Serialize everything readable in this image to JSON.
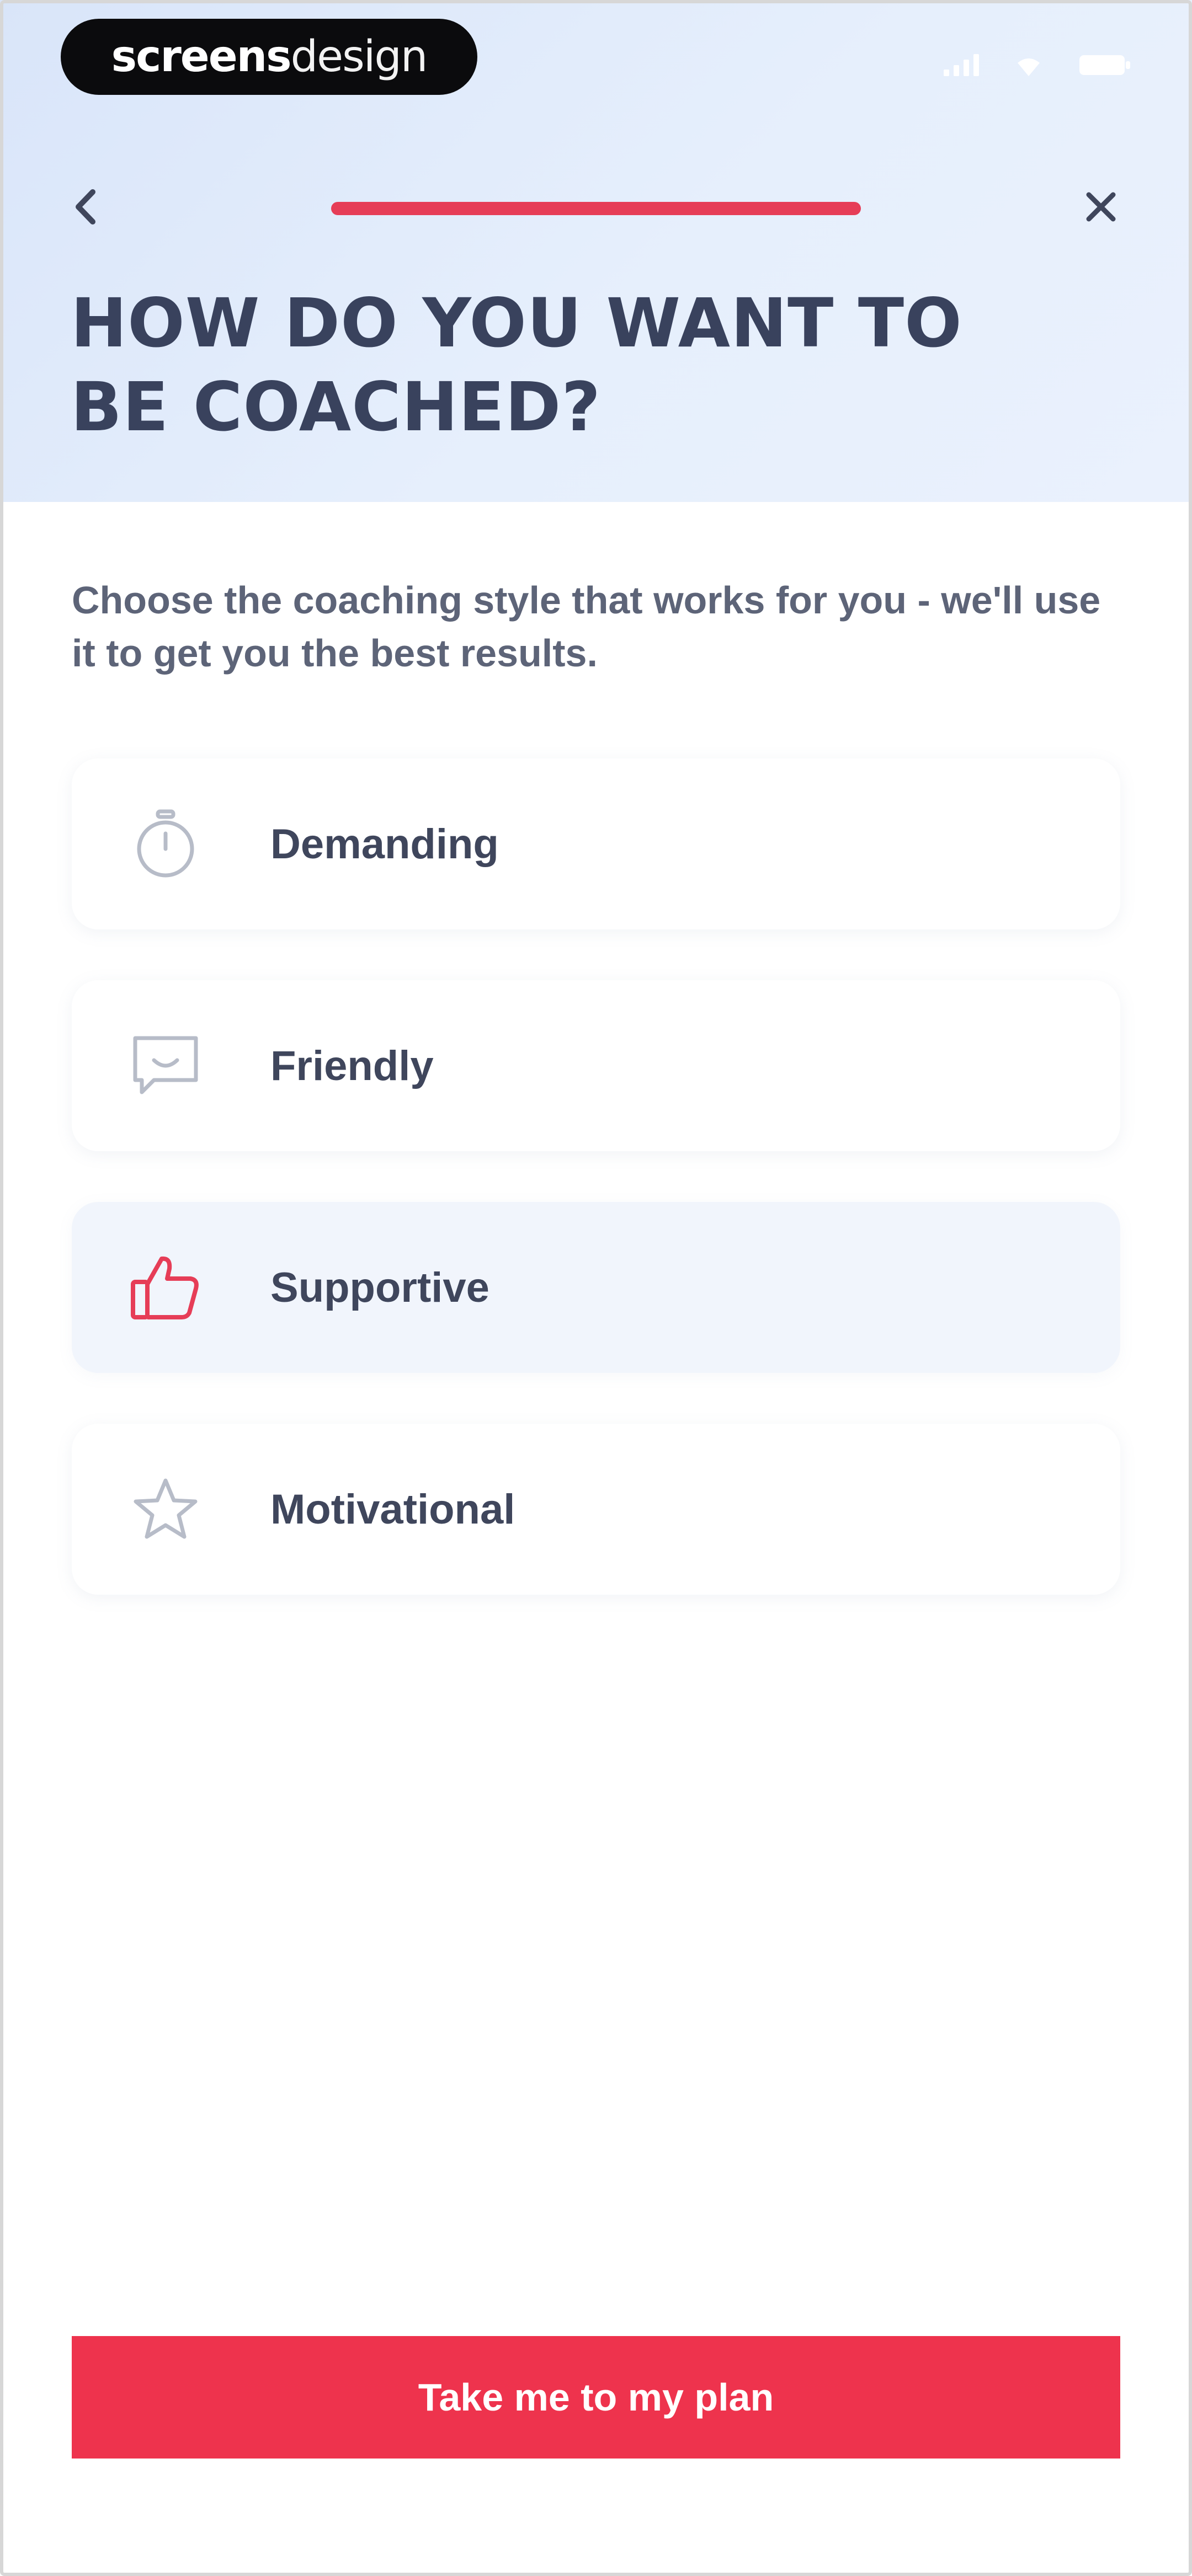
{
  "status_bar": {
    "brand_bold": "screens",
    "brand_thin": "design",
    "icons": [
      "signal-icon",
      "wifi-icon",
      "battery-icon"
    ]
  },
  "nav": {
    "back_icon": "chevron-left-icon",
    "close_icon": "close-icon",
    "progress": 1.0
  },
  "header": {
    "title": "HOW DO YOU WANT TO BE COACHED?"
  },
  "intro": {
    "text": "Choose the coaching style that works for you - we'll use it to get you the best results."
  },
  "options": [
    {
      "label": "Demanding",
      "icon": "stopwatch-icon",
      "selected": false
    },
    {
      "label": "Friendly",
      "icon": "chat-smile-icon",
      "selected": false
    },
    {
      "label": "Supportive",
      "icon": "thumbs-up-icon",
      "selected": true
    },
    {
      "label": "Motivational",
      "icon": "star-icon",
      "selected": false
    }
  ],
  "cta": {
    "label": "Take me to my plan"
  },
  "colors": {
    "accent": "#ee334d",
    "title": "#39425d",
    "text": "#5d6478",
    "icon_inactive": "#b7bcc8",
    "selected_bg": "#f1f5fc"
  }
}
